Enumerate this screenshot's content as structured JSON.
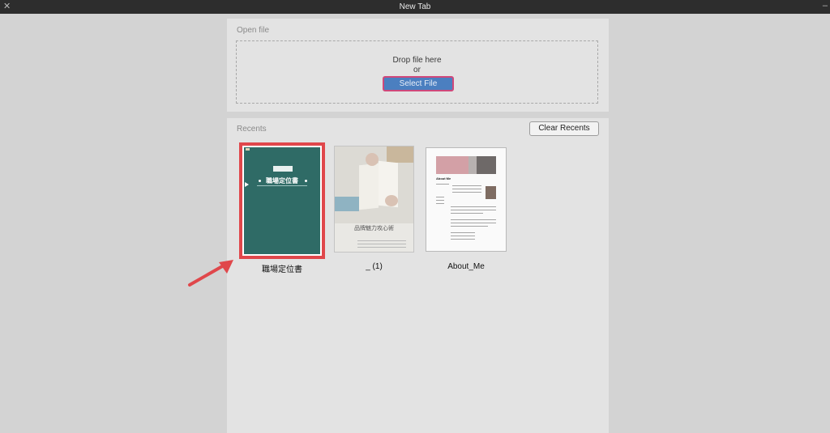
{
  "window": {
    "title": "New Tab"
  },
  "open_file": {
    "heading": "Open file",
    "drop_text": "Drop file here",
    "or_text": "or",
    "select_button": "Select File"
  },
  "recents": {
    "heading": "Recents",
    "clear_button": "Clear Recents",
    "files": [
      {
        "name": "職場定位書",
        "thumb_title": "職場定位書",
        "selected": true
      },
      {
        "name": "_ (1)",
        "thumb_title": "品牌魅力攻心術"
      },
      {
        "name": "About_Me",
        "thumb_title": "About Me"
      }
    ]
  },
  "colors": {
    "highlight": "#e0474b",
    "button_blue": "#4b7fc0",
    "cover_green": "#2f6b66"
  }
}
